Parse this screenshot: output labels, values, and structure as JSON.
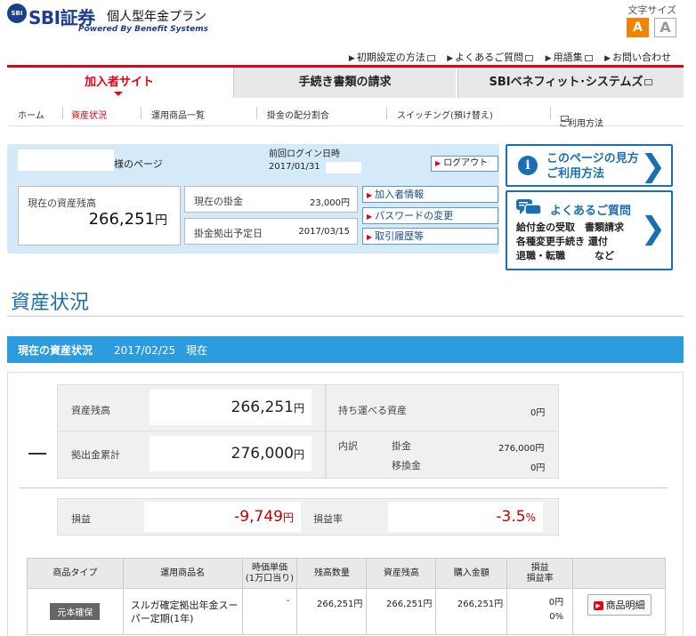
{
  "header": {
    "logo_mark": "SBI",
    "logo_text": "SBI証券",
    "plan_name": "個人型年金プラン",
    "powered_by": "Powered By Benefit Systems",
    "font_size_label": "文字サイズ",
    "font_size_a": "A",
    "font_size_b": "A"
  },
  "top_links": [
    "初期設定の方法",
    "よくあるご質問",
    "用語集",
    "お問い合わせ"
  ],
  "tabs": [
    "加入者サイト",
    "手続き書類の請求",
    "SBIベネフィット･システムズ"
  ],
  "subnav": [
    "ホーム",
    "資産状況",
    "運用商品一覧",
    "掛金の配分割合",
    "スイッチング(預け替え)",
    "ご利用方法"
  ],
  "info": {
    "sama": "様のページ",
    "last_login_label": "前回ログイン日時",
    "last_login_date": "2017/01/31",
    "logout": "ログアウト",
    "balance_label": "現在の資産残高",
    "balance_value": "266,251",
    "yen": "円",
    "current_kakekin_label": "現在の掛金",
    "current_kakekin_value": "23,000円",
    "next_date_label": "掛金拠出予定日",
    "next_date_value": "2017/03/15",
    "links": [
      "加入者情報",
      "パスワードの変更",
      "取引履歴等"
    ]
  },
  "cards": {
    "howto_title": "このページの見方\nご利用方法",
    "faq_title": "よくあるご質問",
    "faq_body": "給付金の受取　書類請求\n各種変更手続き 還付\n退職・転職　　　など"
  },
  "page_title": "資産状況",
  "section": {
    "title": "現在の資産状況",
    "date": "2017/02/25　現在"
  },
  "summary": {
    "balance_label": "資産残高",
    "balance_value": "266,251",
    "contrib_label": "拠出金累計",
    "contrib_value": "276,000",
    "portable_label": "持ち運べる資産",
    "portable_value": "0円",
    "breakdown_label": "内訳",
    "kakekin_label": "掛金",
    "kakekin_value": "276,000円",
    "transfer_label": "移換金",
    "transfer_value": "0円",
    "pl_label": "損益",
    "pl_value": "-9,749",
    "pl_rate_label": "損益率",
    "pl_rate_value": "-3.5",
    "pct": "%",
    "yen": "円"
  },
  "table": {
    "headers": [
      "商品タイプ",
      "運用商品名",
      "時価単価\n(1万口当り)",
      "残高数量",
      "資産残高",
      "購入金額",
      "損益\n損益率",
      ""
    ],
    "rows": [
      {
        "type": "元本確保",
        "name": "スルガ確定拠出年金スーパー定期(1年)",
        "price": "-",
        "quantity": "266,251円",
        "balance": "266,251円",
        "purchase": "266,251円",
        "pl": "0円",
        "pl_rate": "0%",
        "button": "商品明細"
      }
    ]
  },
  "colors": {
    "brand_red": "#e60012",
    "brand_blue": "#1a6fb3",
    "section_blue": "#2d9be0",
    "loss_red": "#c00000"
  }
}
